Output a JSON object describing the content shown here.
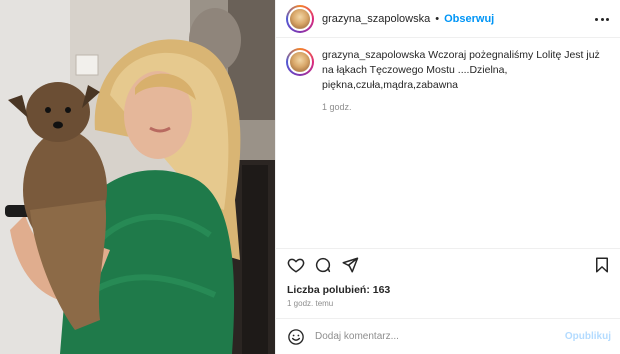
{
  "post": {
    "username": "grazyna_szapolowska",
    "separator": "•",
    "follow_label": "Obserwuj",
    "caption": "Wczoraj pożegnaliśmy Lolitę Jest już na łąkach Tęczowego Mostu ....Dzielna, piękna,czuła,mądra,zabawna",
    "caption_time": "1 godz.",
    "likes_text": "Liczba polubień: 163",
    "posted_time": "1 godz. temu"
  },
  "comment": {
    "placeholder": "Dodaj komentarz...",
    "publish_label": "Opublikuj"
  },
  "icons": {
    "like": "heart-icon",
    "comment": "comment-icon",
    "share": "send-icon",
    "save": "bookmark-icon",
    "more": "more-options-icon",
    "emoji": "emoji-icon"
  },
  "colors": {
    "accent": "#0095f6",
    "publish_disabled": "#b3dbff",
    "muted": "#8e8e8e",
    "text": "#262626"
  }
}
